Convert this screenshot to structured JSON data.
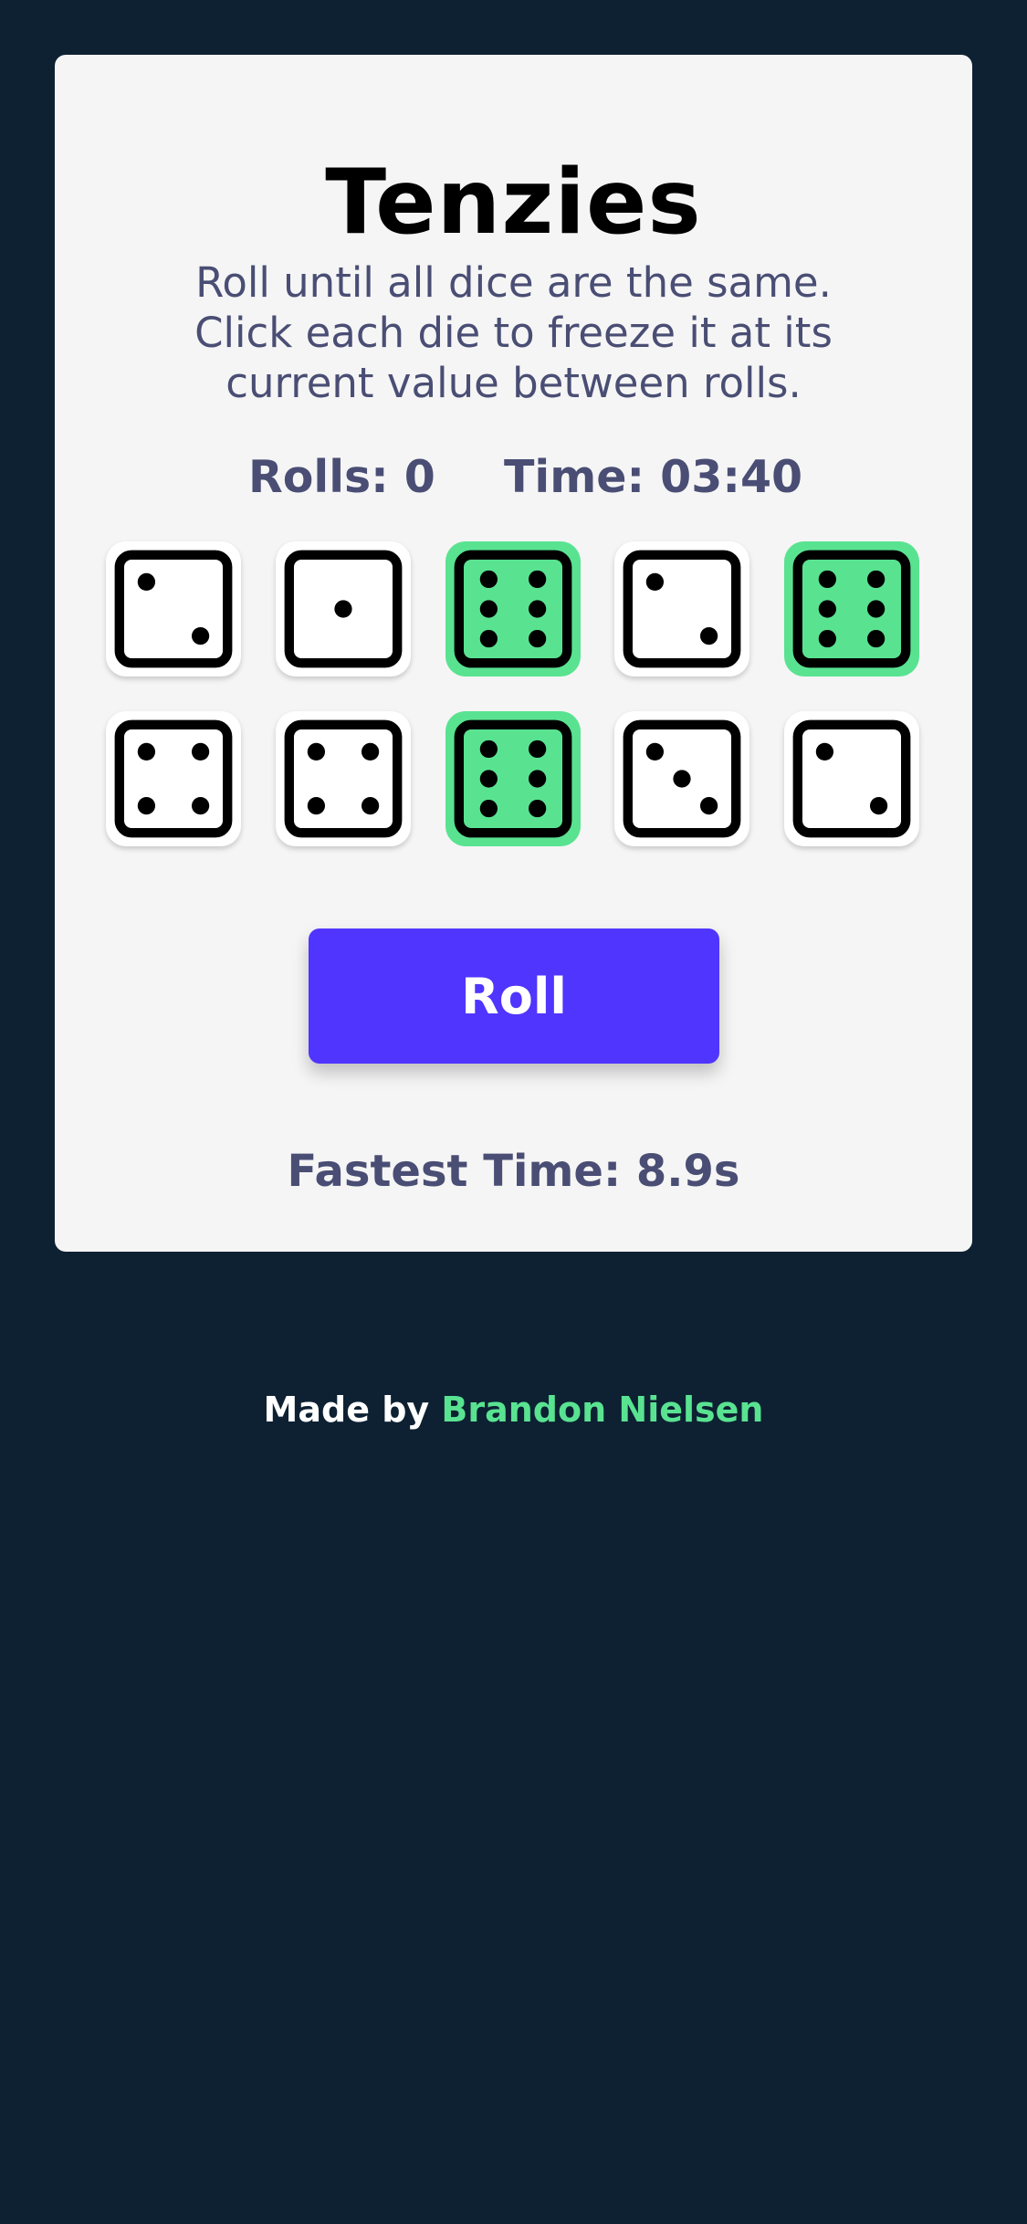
{
  "game": {
    "title": "Tenzies",
    "instructions": "Roll until all dice are the same. Click each die to freeze it at its current value between rolls.",
    "rolls_label": "Rolls: 0",
    "time_label": "Time: 03:40",
    "roll_button_label": "Roll",
    "fastest_time": "Fastest Time: 8.9s"
  },
  "dice": [
    {
      "value": 2,
      "held": false
    },
    {
      "value": 1,
      "held": false
    },
    {
      "value": 6,
      "held": true
    },
    {
      "value": 2,
      "held": false
    },
    {
      "value": 6,
      "held": true
    },
    {
      "value": 4,
      "held": false
    },
    {
      "value": 4,
      "held": false
    },
    {
      "value": 6,
      "held": true
    },
    {
      "value": 3,
      "held": false
    },
    {
      "value": 2,
      "held": false
    }
  ],
  "footer": {
    "prefix": "Made by ",
    "author": "Brandon Nielsen"
  },
  "colors": {
    "background": "#0d2133",
    "card": "#f5f5f5",
    "accent": "#5035ff",
    "held": "#59e391",
    "muted_text": "#4a4e74"
  }
}
